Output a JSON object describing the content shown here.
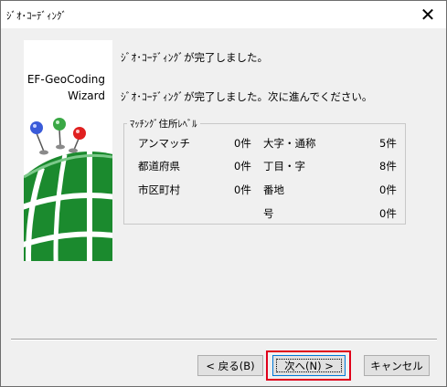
{
  "window": {
    "title": "ｼﾞｵ･ｺｰﾃﾞｨﾝｸﾞ",
    "close_glyph": "✕"
  },
  "banner": {
    "line1": "EF-GeoCoding",
    "line2": "Wizard"
  },
  "header": {
    "complete_text": "ｼﾞｵ･ｺｰﾃﾞｨﾝｸﾞが完了しました。",
    "sub_text": "ｼﾞｵ･ｺｰﾃﾞｨﾝｸﾞが完了しました。次に進んでください。"
  },
  "group": {
    "label": "ﾏｯﾁﾝｸﾞ住所ﾚﾍﾞﾙ",
    "rows": [
      {
        "left_label": "アンマッチ",
        "left_value": "0件",
        "right_label": "大字・通称",
        "right_value": "5件"
      },
      {
        "left_label": "都道府県",
        "left_value": "0件",
        "right_label": "丁目・字",
        "right_value": "8件"
      },
      {
        "left_label": "市区町村",
        "left_value": "0件",
        "right_label": "番地",
        "right_value": "0件"
      },
      {
        "left_label": "",
        "left_value": "",
        "right_label": "号",
        "right_value": "0件"
      }
    ]
  },
  "buttons": {
    "back": "< 戻る(B)",
    "next": "次へ(N) >",
    "cancel": "キャンセル"
  },
  "colors": {
    "highlight": "#e0001b",
    "globe_green": "#1b8a2e",
    "pin_blue": "#3a5bd9",
    "pin_green": "#3aa845",
    "pin_red": "#e02020"
  }
}
